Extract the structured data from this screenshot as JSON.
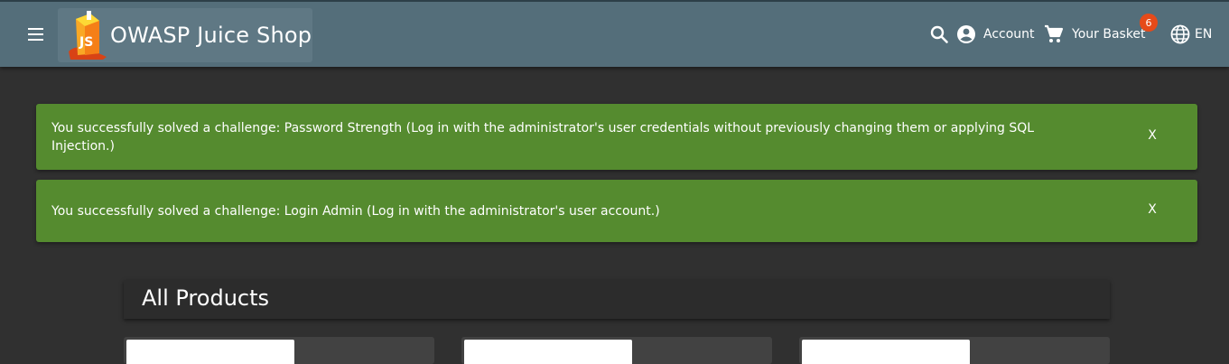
{
  "header": {
    "title": "OWASP Juice Shop",
    "account_label": "Account",
    "basket_label": "Your Basket",
    "basket_count": "6",
    "language_label": "EN"
  },
  "notifications": [
    {
      "text": "You successfully solved a challenge: Password Strength (Log in with the administrator's user credentials without previously changing them or applying SQL Injection.)",
      "close_label": "X"
    },
    {
      "text": "You successfully solved a challenge: Login Admin (Log in with the administrator's user account.)",
      "close_label": "X"
    }
  ],
  "main": {
    "heading": "All Products"
  },
  "colors": {
    "toolbar": "#546e7a",
    "background": "#303030",
    "notification": "#558b2f",
    "badge": "#e64a19"
  },
  "icons": [
    "menu-icon",
    "juice-shop-logo",
    "search-icon",
    "account-circle-icon",
    "shopping-cart-icon",
    "language-icon"
  ]
}
